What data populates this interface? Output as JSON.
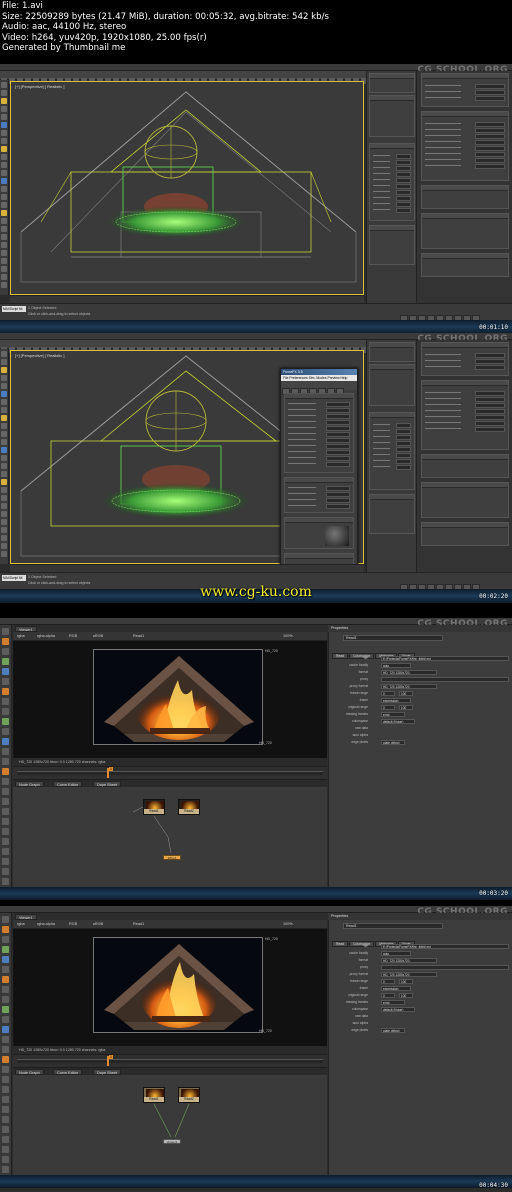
{
  "file_info": {
    "file": "File: 1.avi",
    "size": "Size: 22509289 bytes (21.47 MiB), duration: 00:05:32, avg.bitrate: 542 kb/s",
    "audio": "Audio: aac, 44100 Hz, stereo",
    "video": "Video: h264, yuv420p, 1920x1080, 25.00 fps(r)",
    "generator": "Generated by Thumbnail me"
  },
  "watermark_text": "www.cg-ku.com",
  "channel_logo": "CG SCHOOL.ORG",
  "frames": [
    {
      "timestamp": "00:01:10",
      "app": "3ds Max",
      "viewport_label": "[+] [Perspective] [ Realistic ]",
      "listener_label": "MAXScript Mi",
      "status_line_1": "1 Object Selected",
      "status_line_2": "Click or click-and-drag to select objects",
      "modifier_list_label": "Modifier List",
      "panel_items": [
        "FumeFX",
        "General Parameters",
        "Simulation",
        "Illumination",
        "Rendering"
      ]
    },
    {
      "timestamp": "00:02:20",
      "app": "3ds Max",
      "viewport_label": "[+] [Perspective] [ Realistic ]",
      "listener_label": "MAXScript Mi",
      "status_line_1": "1 Object Selected",
      "status_line_2": "Click or click-and-drag to select objects",
      "dialog_title": "FumeFX 3.5",
      "dialog_menu": "File  Preferences  Sim. Modes  Preview  Help",
      "dialog_sections": [
        "Simulation",
        "System",
        "Turbulence Noise",
        "Blocking Sides"
      ]
    },
    {
      "timestamp": "00:03:20",
      "app": "Nuke",
      "menu": [
        "File",
        "Edit",
        "Workspace",
        "Viewer",
        "Render",
        "Cache",
        "Help"
      ],
      "viewer_tab": "Viewer1",
      "props_title": "Properties",
      "node_name": "Read1",
      "props_tabs": [
        "Read",
        "Colorspace",
        "Metadata",
        "Node"
      ],
      "graph_tabs": [
        "Node Graph",
        "Curve Editor",
        "Dope Sheet"
      ],
      "info_line": "HD_720 1280x720  bbox: 0 0 1280 720 channels: rgba",
      "frame_head": "1",
      "nodes": [
        "Read1",
        "Read2"
      ],
      "write_label": "Write1"
    },
    {
      "timestamp": "00:04:30",
      "app": "Nuke",
      "menu": [
        "File",
        "Edit",
        "Workspace",
        "Viewer",
        "Render",
        "Cache",
        "Help"
      ],
      "viewer_tab": "Viewer1",
      "props_title": "Properties",
      "node_name": "Read1",
      "props_tabs": [
        "Read",
        "Colorspace",
        "Metadata",
        "Node"
      ],
      "graph_tabs": [
        "Node Graph",
        "Curve Editor",
        "Dope Sheet"
      ],
      "info_line": "HD_720 1280x720  bbox: 0 0 1280 720 channels: rgba",
      "frame_head": "1",
      "nodes": [
        "Read1",
        "Read2"
      ],
      "write_label": "Viewer1"
    }
  ],
  "colors": {
    "selection_yellow": "#d9c23a",
    "fumefx_green": "#58c24a",
    "nuke_orange": "#e28a2d",
    "watermark_yellow": "#f4ee30"
  }
}
